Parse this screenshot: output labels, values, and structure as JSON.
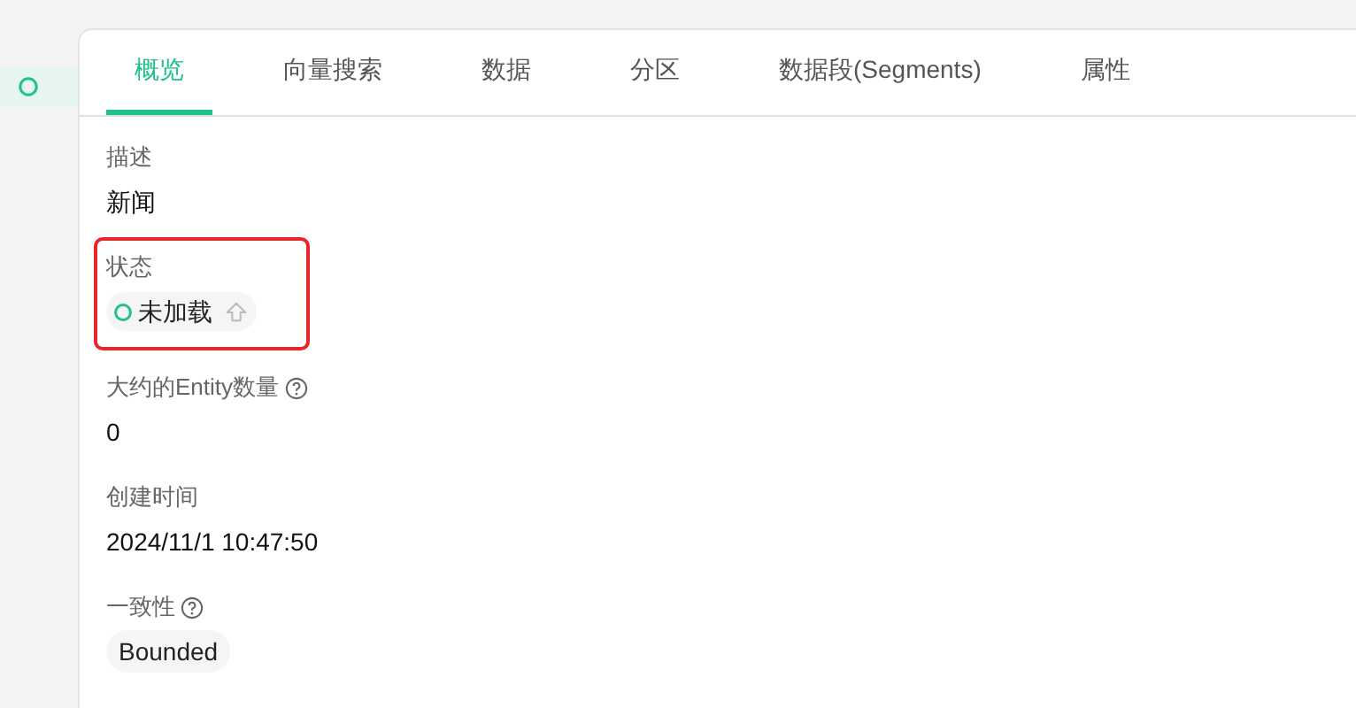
{
  "sidebar": {
    "items": [
      {
        "selected": true
      }
    ]
  },
  "tabs": [
    {
      "label": "概览",
      "selected": true
    },
    {
      "label": "向量搜索",
      "selected": false
    },
    {
      "label": "数据",
      "selected": false
    },
    {
      "label": "分区",
      "selected": false
    },
    {
      "label": "数据段(Segments)",
      "selected": false
    },
    {
      "label": "属性",
      "selected": false
    }
  ],
  "fields": [
    {
      "kind": "text",
      "label": "描述",
      "value": "新闻",
      "help": false,
      "highlighted": false
    },
    {
      "kind": "status",
      "label": "状态",
      "value": "未加载",
      "help": false,
      "highlighted": true
    },
    {
      "kind": "text",
      "label": "大约的Entity数量",
      "value": "0",
      "help": true,
      "highlighted": false
    },
    {
      "kind": "text",
      "label": "创建时间",
      "value": "2024/11/1 10:47:50",
      "help": false,
      "highlighted": false
    },
    {
      "kind": "tag",
      "label": "一致性",
      "value": "Bounded",
      "help": true,
      "highlighted": false
    }
  ]
}
